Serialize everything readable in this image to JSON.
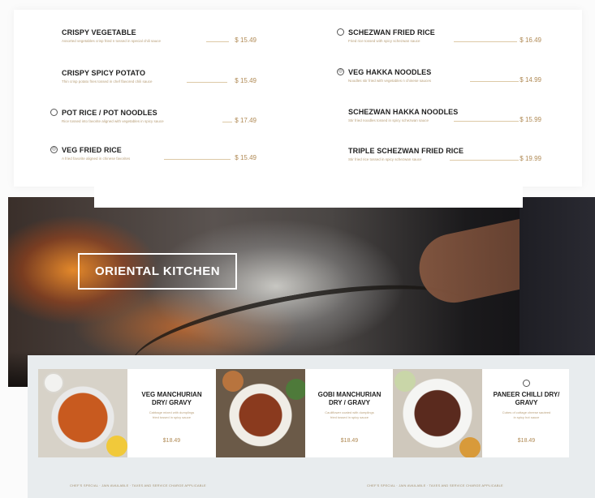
{
  "menu": {
    "left": [
      {
        "name": "CRISPY VEGETABLE",
        "desc": "Assorted vegetables crisp fried n tossed in special chili sauce",
        "price": "$ 15.49",
        "icon": ""
      },
      {
        "name": "CRISPY SPICY POTATO",
        "desc": "Thin crisp potato fries tossed in chef flavored chili sauce",
        "price": "$ 15.49",
        "icon": ""
      },
      {
        "name": "POT RICE / POT NOODLES",
        "desc": "Rice tossed into favorite aligned with vegetables in spicy sauce",
        "price": "$ 17.49",
        "icon": "chef-hat-icon"
      },
      {
        "name": "VEG FRIED RICE",
        "desc": "A fried favorite aligned in chinese favorites",
        "price": "$ 15.49",
        "icon": "jain-icon"
      }
    ],
    "right": [
      {
        "name": "SCHEZWAN FRIED RICE",
        "desc": "Fried rice tossed with spicy schezwan sauce",
        "price": "$ 16.49",
        "icon": "chef-hat-icon"
      },
      {
        "name": "VEG HAKKA NOODLES",
        "desc": "Noodles stir fried with vegetables n chinese sauces",
        "price": "$ 14.99",
        "icon": "jain-icon"
      },
      {
        "name": "SCHEZWAN HAKKA NOODLES",
        "desc": "Stir fried noodles tossed in spicy schezwan sauce",
        "price": "$ 15.99",
        "icon": ""
      },
      {
        "name": "TRIPLE SCHEZWAN FRIED RICE",
        "desc": "Stir fried rice tossed in spicy schezwan sauce",
        "price": "$ 19.99",
        "icon": ""
      }
    ]
  },
  "hero": {
    "title": "ORIENTAL KITCHEN"
  },
  "dishes": [
    {
      "name": "VEG MANCHURIAN DRY/ GRAVY",
      "desc": "Cabbage mixed with dumplings fried tossed in spicy sauce",
      "price": "$18.49"
    },
    {
      "name": "GOBI MANCHURIAN DRY / GRAVY",
      "desc": "Cauliflower coated with dumplings fried tossed in spicy sauce",
      "price": "$18.49"
    },
    {
      "name": "PANEER CHILLI DRY/ GRAVY",
      "desc": "Cubes of cottage cheese sauteed in spicy hot sauce",
      "price": "$18.49"
    }
  ],
  "legend": {
    "left": "CHEF'S SPECIAL   ·   JAIN AVAILABLE   ·   TAXES AND SERVICE CHARGE APPLICABLE",
    "right": "CHEF'S SPECIAL   ·   JAIN AVAILABLE   ·   TAXES AND SERVICE CHARGE APPLICABLE"
  },
  "colors": {
    "accent_gold": "#b08a55",
    "panel_gray": "#e8ecee"
  }
}
